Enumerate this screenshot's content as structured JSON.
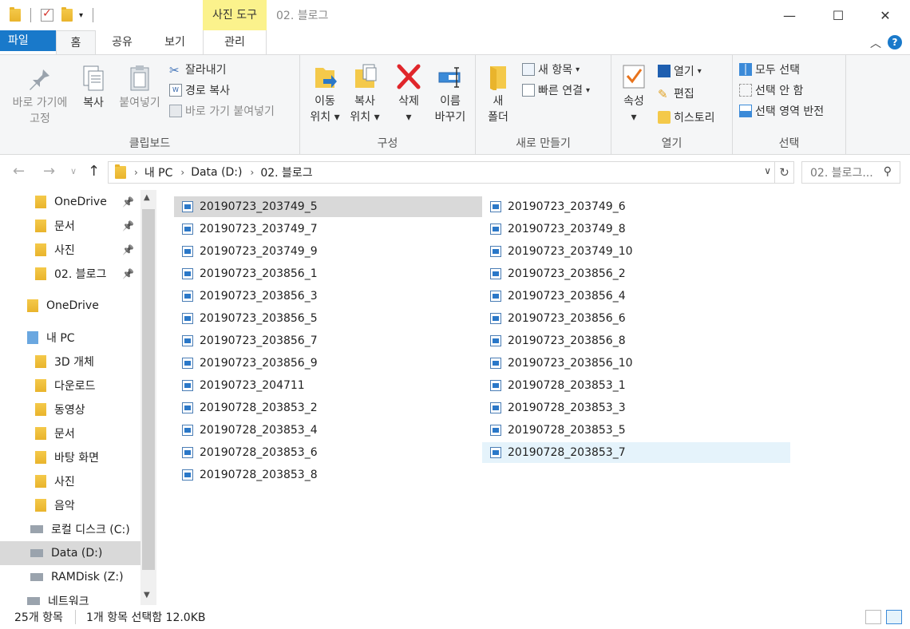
{
  "titlebar": {
    "context_tab": "사진 도구",
    "title": "02. 블로그",
    "minimize": "—",
    "maximize": "☐",
    "close": "✕"
  },
  "tabs": {
    "file": "파일",
    "home": "홈",
    "share": "공유",
    "view": "보기",
    "manage": "관리"
  },
  "ribbon": {
    "clipboard": {
      "pin": "바로 가기에 고정",
      "copy": "복사",
      "paste": "붙여넣기",
      "cut": "잘라내기",
      "copy_path": "경로 복사",
      "paste_shortcut": "바로 가기 붙여넣기",
      "label": "클립보드"
    },
    "organize": {
      "move": "이동",
      "move2": "위치",
      "copyto": "복사",
      "copyto2": "위치",
      "delete": "삭제",
      "rename": "이름",
      "rename2": "바꾸기",
      "label": "구성"
    },
    "new": {
      "new_folder": "새",
      "new_folder2": "폴더",
      "new_item": "새 항목",
      "easy_access": "빠른 연결",
      "label": "새로 만들기"
    },
    "open": {
      "properties": "속성",
      "open": "열기",
      "edit": "편집",
      "history": "히스토리",
      "label": "열기"
    },
    "select": {
      "select_all": "모두 선택",
      "select_none": "선택 안 함",
      "invert": "선택 영역 반전",
      "label": "선택"
    }
  },
  "address": {
    "crumbs": [
      "내 PC",
      "Data (D:)",
      "02. 블로그"
    ],
    "search_placeholder": "02. 블로그..."
  },
  "nav": [
    {
      "label": "OneDrive",
      "pinned": true
    },
    {
      "label": "문서",
      "pinned": true
    },
    {
      "label": "사진",
      "pinned": true
    },
    {
      "label": "02. 블로그",
      "pinned": true
    },
    {
      "label": "OneDrive",
      "pinned": false
    },
    {
      "label": "내 PC",
      "pinned": false
    },
    {
      "label": "3D 개체",
      "pinned": false
    },
    {
      "label": "다운로드",
      "pinned": false
    },
    {
      "label": "동영상",
      "pinned": false
    },
    {
      "label": "문서",
      "pinned": false
    },
    {
      "label": "바탕 화면",
      "pinned": false
    },
    {
      "label": "사진",
      "pinned": false
    },
    {
      "label": "음악",
      "pinned": false
    },
    {
      "label": "로컬 디스크 (C:)",
      "pinned": false
    },
    {
      "label": "Data (D:)",
      "pinned": false
    },
    {
      "label": "RAMDisk (Z:)",
      "pinned": false
    },
    {
      "label": "네트워크",
      "pinned": false
    }
  ],
  "files": [
    "20190723_203749_5",
    "20190723_203749_6",
    "20190723_203749_7",
    "20190723_203749_8",
    "20190723_203749_9",
    "20190723_203749_10",
    "20190723_203856_1",
    "20190723_203856_2",
    "20190723_203856_3",
    "20190723_203856_4",
    "20190723_203856_5",
    "20190723_203856_6",
    "20190723_203856_7",
    "20190723_203856_8",
    "20190723_203856_9",
    "20190723_203856_10",
    "20190723_204711",
    "20190728_203853_1",
    "20190728_203853_2",
    "20190728_203853_3",
    "20190728_203853_4",
    "20190728_203853_5",
    "20190728_203853_6",
    "20190728_203853_7",
    "20190728_203853_8"
  ],
  "status": {
    "count": "25개 항목",
    "selection": "1개 항목 선택함 12.0KB"
  }
}
